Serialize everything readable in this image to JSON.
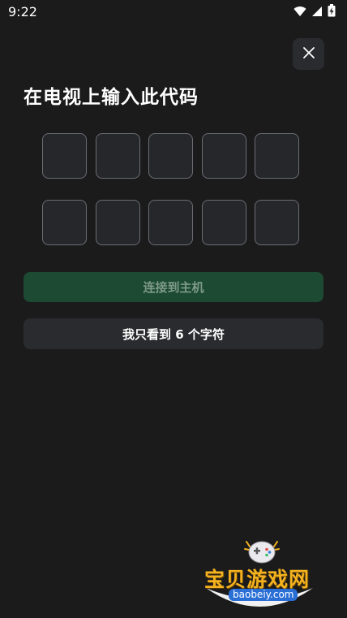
{
  "status_bar": {
    "time": "9:22",
    "icons": [
      "wifi-icon",
      "signal-icon",
      "battery-charging-icon"
    ]
  },
  "close_icon": "close-icon",
  "title": "在电视上输入此代码",
  "code_input": {
    "length": 10,
    "values": [
      "",
      "",
      "",
      "",
      "",
      "",
      "",
      "",
      "",
      ""
    ]
  },
  "buttons": {
    "connect": "连接到主机",
    "only_six": "我只看到 6 个字符"
  },
  "watermark": {
    "name": "宝贝游戏网",
    "url": "baobeiy.com"
  },
  "colors": {
    "background": "#1b1b1c",
    "box_border": "#6b6d73",
    "connect_bg": "#1d4a33",
    "connect_text": "#7e9a89",
    "secondary_button_bg": "#2a2b2e"
  }
}
